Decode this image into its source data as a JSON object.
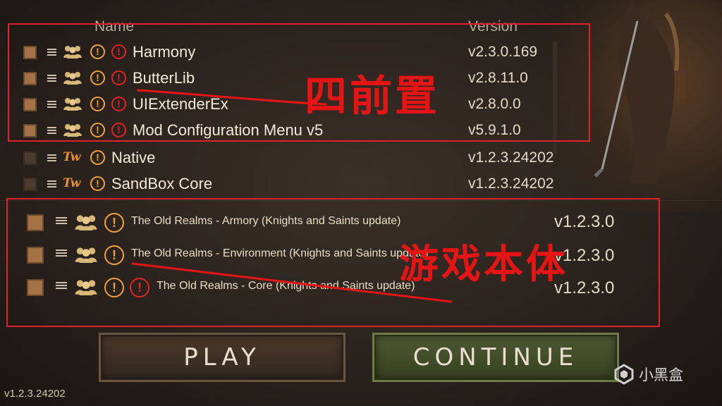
{
  "columns": {
    "name": "Name",
    "version": "Version"
  },
  "mods_group1": [
    {
      "name": "Harmony",
      "version": "v2.3.0.169"
    },
    {
      "name": "ButterLib",
      "version": "v2.8.11.0"
    },
    {
      "name": "UIExtenderEx",
      "version": "v2.8.0.0"
    },
    {
      "name": "Mod Configuration Menu v5",
      "version": "v5.9.1.0"
    }
  ],
  "mods_official": [
    {
      "name": "Native",
      "version": "v1.2.3.24202",
      "icon": "tw-logo-icon"
    },
    {
      "name": "SandBox Core",
      "version": "v1.2.3.24202",
      "icon": "tw-logo-icon"
    }
  ],
  "mods_group2": [
    {
      "name": "The Old Realms - Armory (Knights and Saints update)",
      "version": "v1.2.3.0"
    },
    {
      "name": "The Old Realms - Environment (Knights and Saints update)",
      "version": "v1.2.3.0"
    },
    {
      "name": "The Old Realms - Core (Knights and Saints update)",
      "version": "v1.2.3.0"
    }
  ],
  "annotations": {
    "prerequisites": "四前置",
    "game_body": "游戏本体"
  },
  "buttons": {
    "play": "PLAY",
    "continue": "CONTINUE"
  },
  "footer": {
    "game_version": "v1.2.3.24202"
  },
  "watermark": {
    "text": "小黑盒"
  },
  "colors": {
    "annotation_red": "#e0202a",
    "warning_orange": "#f0a23a",
    "error_red": "#e42424"
  }
}
